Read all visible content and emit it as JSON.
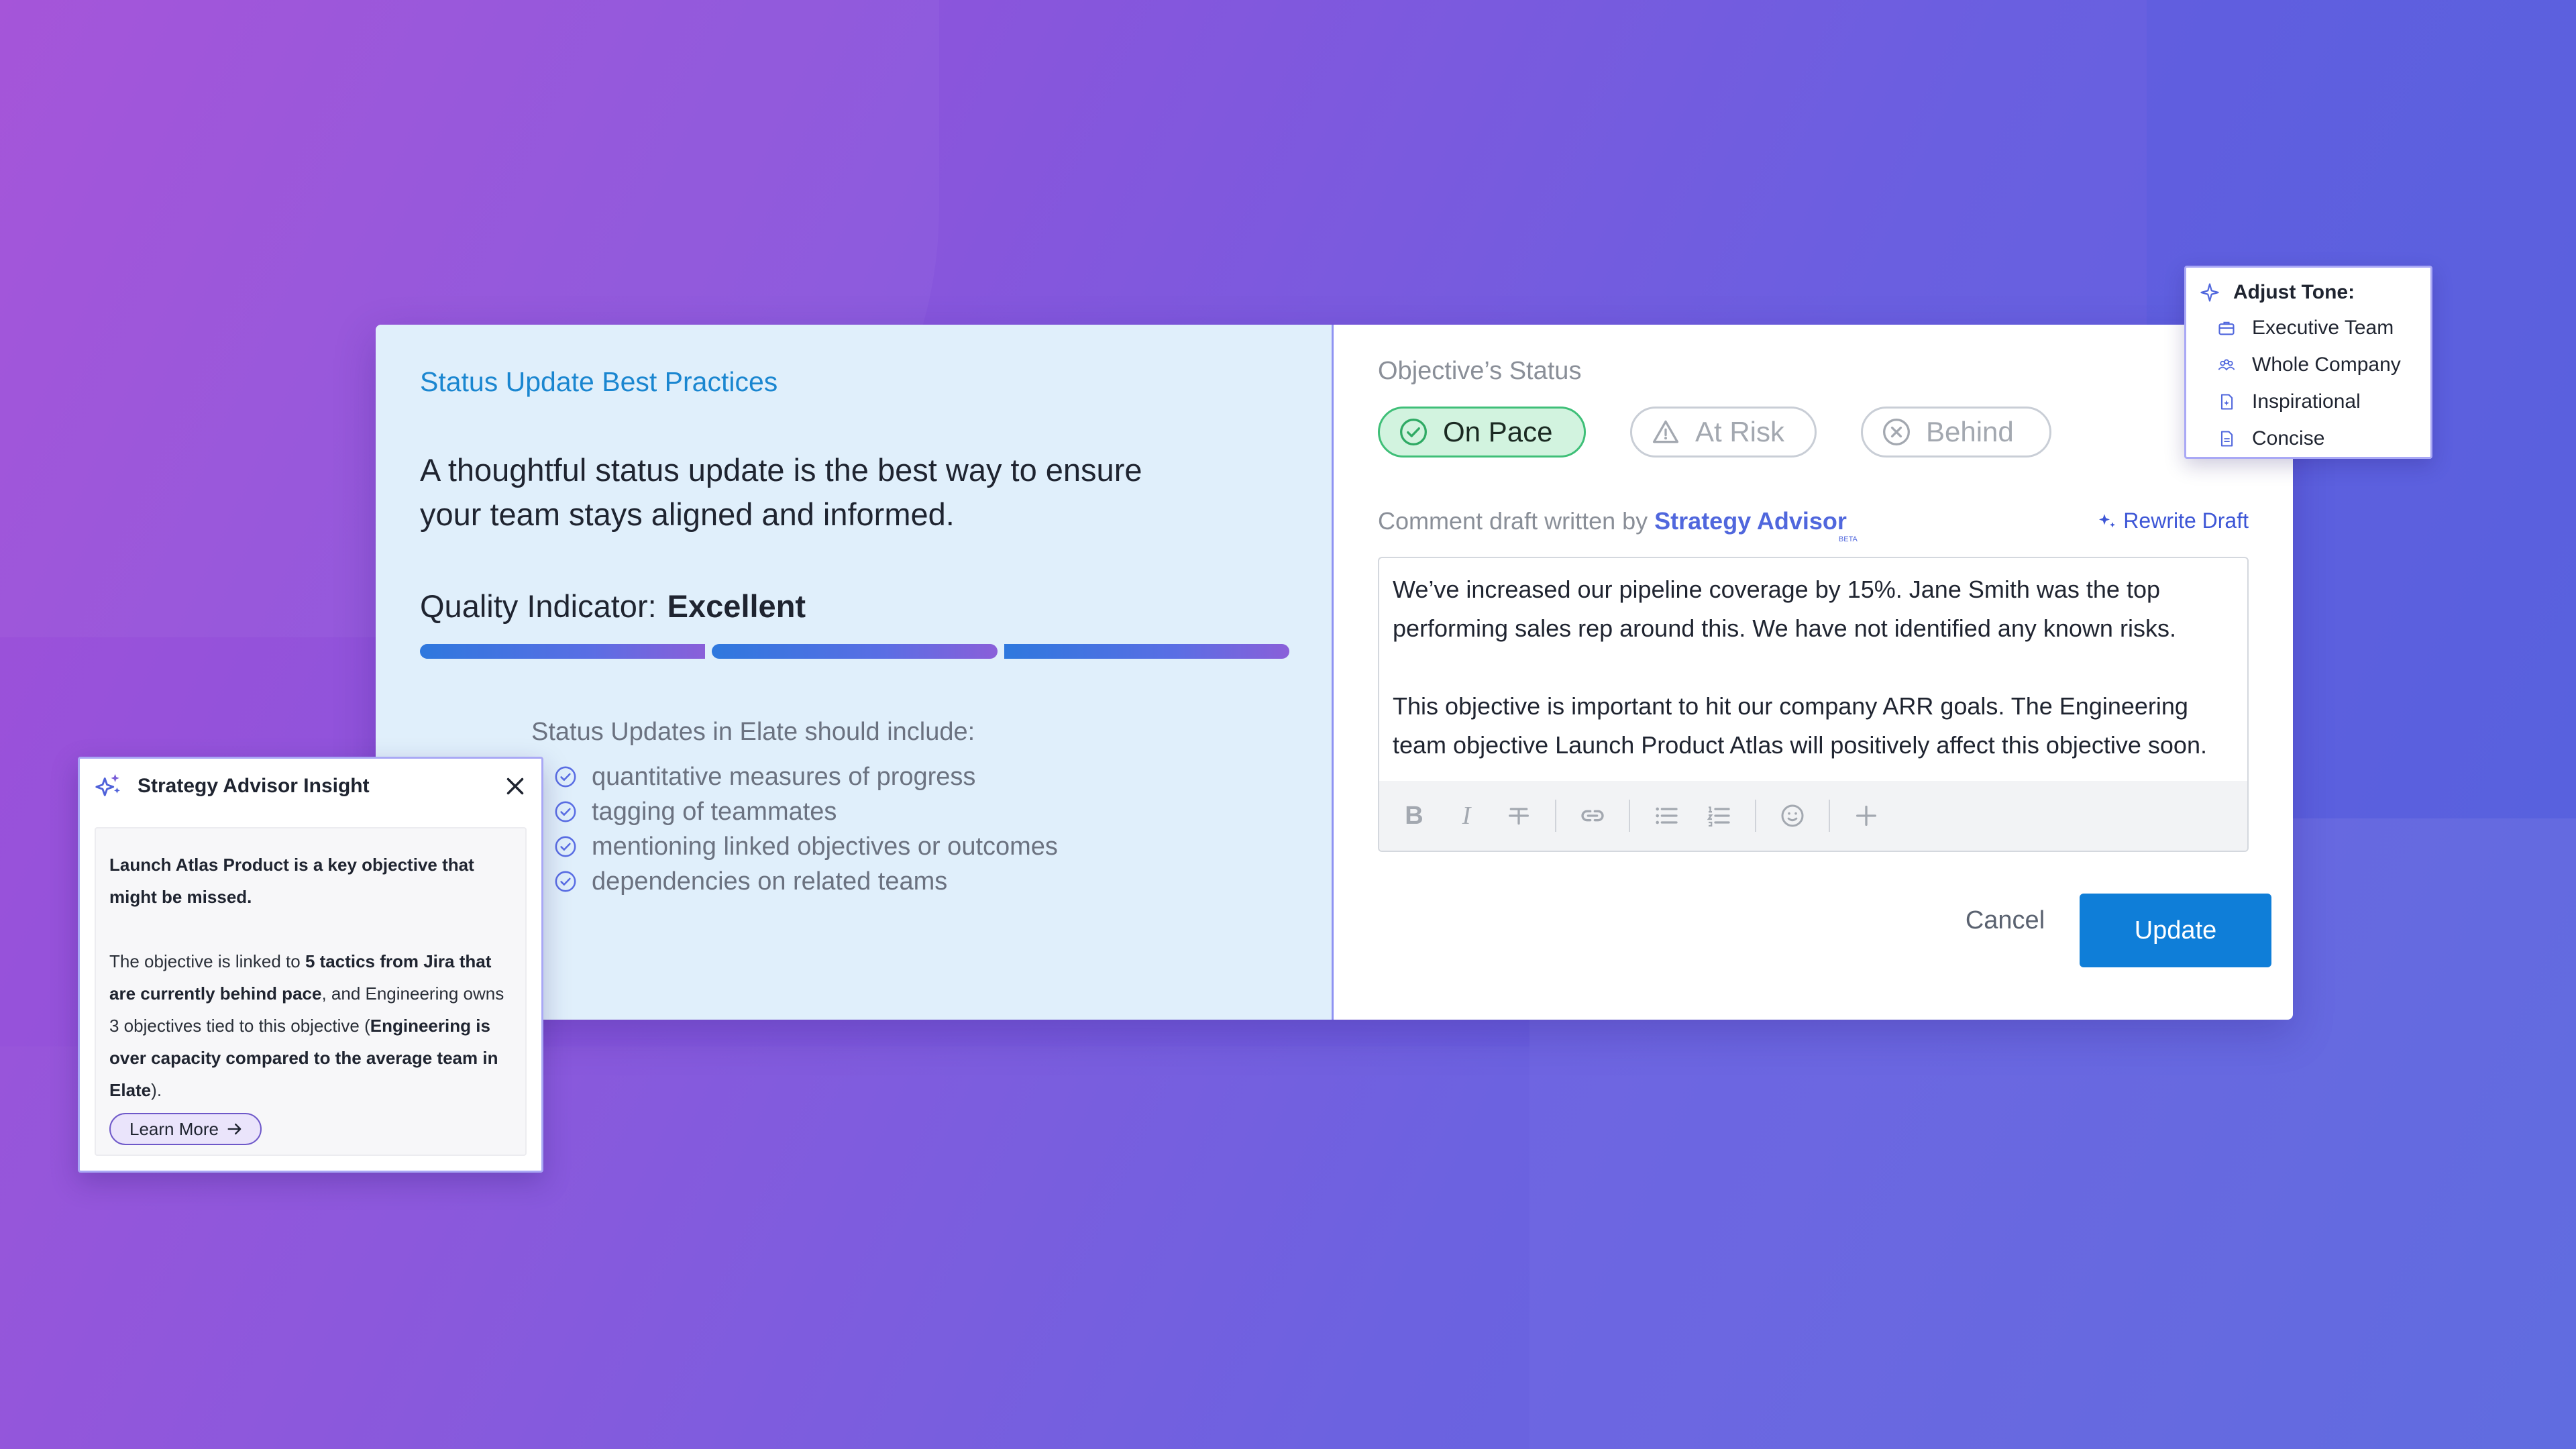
{
  "best_practices": {
    "title": "Status Update Best Practices",
    "description": "A thoughtful status update is the best way to ensure your team stays aligned and informed.",
    "quality_label": "Quality Indicator:",
    "quality_value": "Excellent",
    "quality_segments_filled": 3,
    "quality_segments_total": 3,
    "include_title": "Status Updates in Elate should include:",
    "include_items": [
      "quantitative measures of progress",
      "tagging of teammates",
      "mentioning linked objectives or outcomes",
      "dependencies on related teams"
    ]
  },
  "status": {
    "label": "Objective’s Status",
    "options": [
      {
        "label": "On Pace",
        "icon": "check-circle-icon",
        "active": true
      },
      {
        "label": "At Risk",
        "icon": "warning-triangle-icon",
        "active": false
      },
      {
        "label": "Behind",
        "icon": "x-circle-icon",
        "active": false
      }
    ]
  },
  "draft": {
    "label_prefix": "Comment draft written by",
    "brand": "Strategy Advisor",
    "brand_badge": "BETA",
    "rewrite_label": "Rewrite Draft",
    "paragraphs": [
      "We’ve increased our pipeline coverage by 15%. Jane Smith was the top performing sales rep around this. We have not identified any known risks.",
      "This objective is important to hit our company ARR goals. The Engineering team objective Launch Product Atlas will positively affect this objective soon."
    ],
    "toolbar_icons": [
      "bold-icon",
      "italic-icon",
      "strikethrough-icon",
      "link-icon",
      "bullet-list-icon",
      "numbered-list-icon",
      "emoji-icon",
      "plus-icon"
    ]
  },
  "actions": {
    "cancel": "Cancel",
    "update": "Update"
  },
  "tone": {
    "title": "Adjust Tone:",
    "items": [
      {
        "label": "Executive Team",
        "icon": "briefcase-icon"
      },
      {
        "label": "Whole Company",
        "icon": "people-icon"
      },
      {
        "label": "Inspirational",
        "icon": "sparkle-doc-icon"
      },
      {
        "label": "Concise",
        "icon": "document-icon"
      }
    ]
  },
  "insight": {
    "title": "Strategy Advisor Insight",
    "p1_bold": "Launch Atlas Product is a key objective that might be missed.",
    "p2_a": "The objective is linked to ",
    "p2_b": "5 tactics from Jira that are currently behind pace",
    "p2_c": ", and Engineering owns 3 objectives tied to this objective (",
    "p2_d": "Engineering is over capacity compared to the average team in Elate",
    "p2_e": ").",
    "learn_more": "Learn More"
  },
  "colors": {
    "accent_blue": "#0f7ed8",
    "brand_purple": "#5067dd",
    "on_pace_green": "#3fbf78",
    "panel_blue": "#e0effb"
  }
}
